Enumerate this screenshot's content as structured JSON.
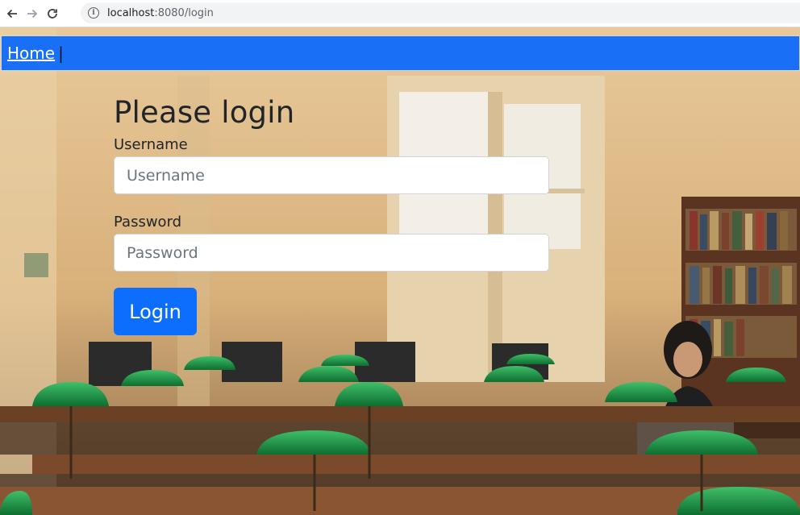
{
  "browser": {
    "url_host": "localhost",
    "url_path": ":8080/login",
    "back_icon": "arrow-left-icon",
    "forward_icon": "arrow-right-icon",
    "reload_icon": "reload-icon",
    "info_icon": "info-icon"
  },
  "nav": {
    "home_label": "Home",
    "separator": "|",
    "background_color": "#1a6ff7"
  },
  "form": {
    "title": "Please login",
    "username_label": "Username",
    "username_placeholder": "Username",
    "password_label": "Password",
    "password_placeholder": "Password",
    "submit_label": "Login",
    "accent_color": "#0d6efd"
  }
}
